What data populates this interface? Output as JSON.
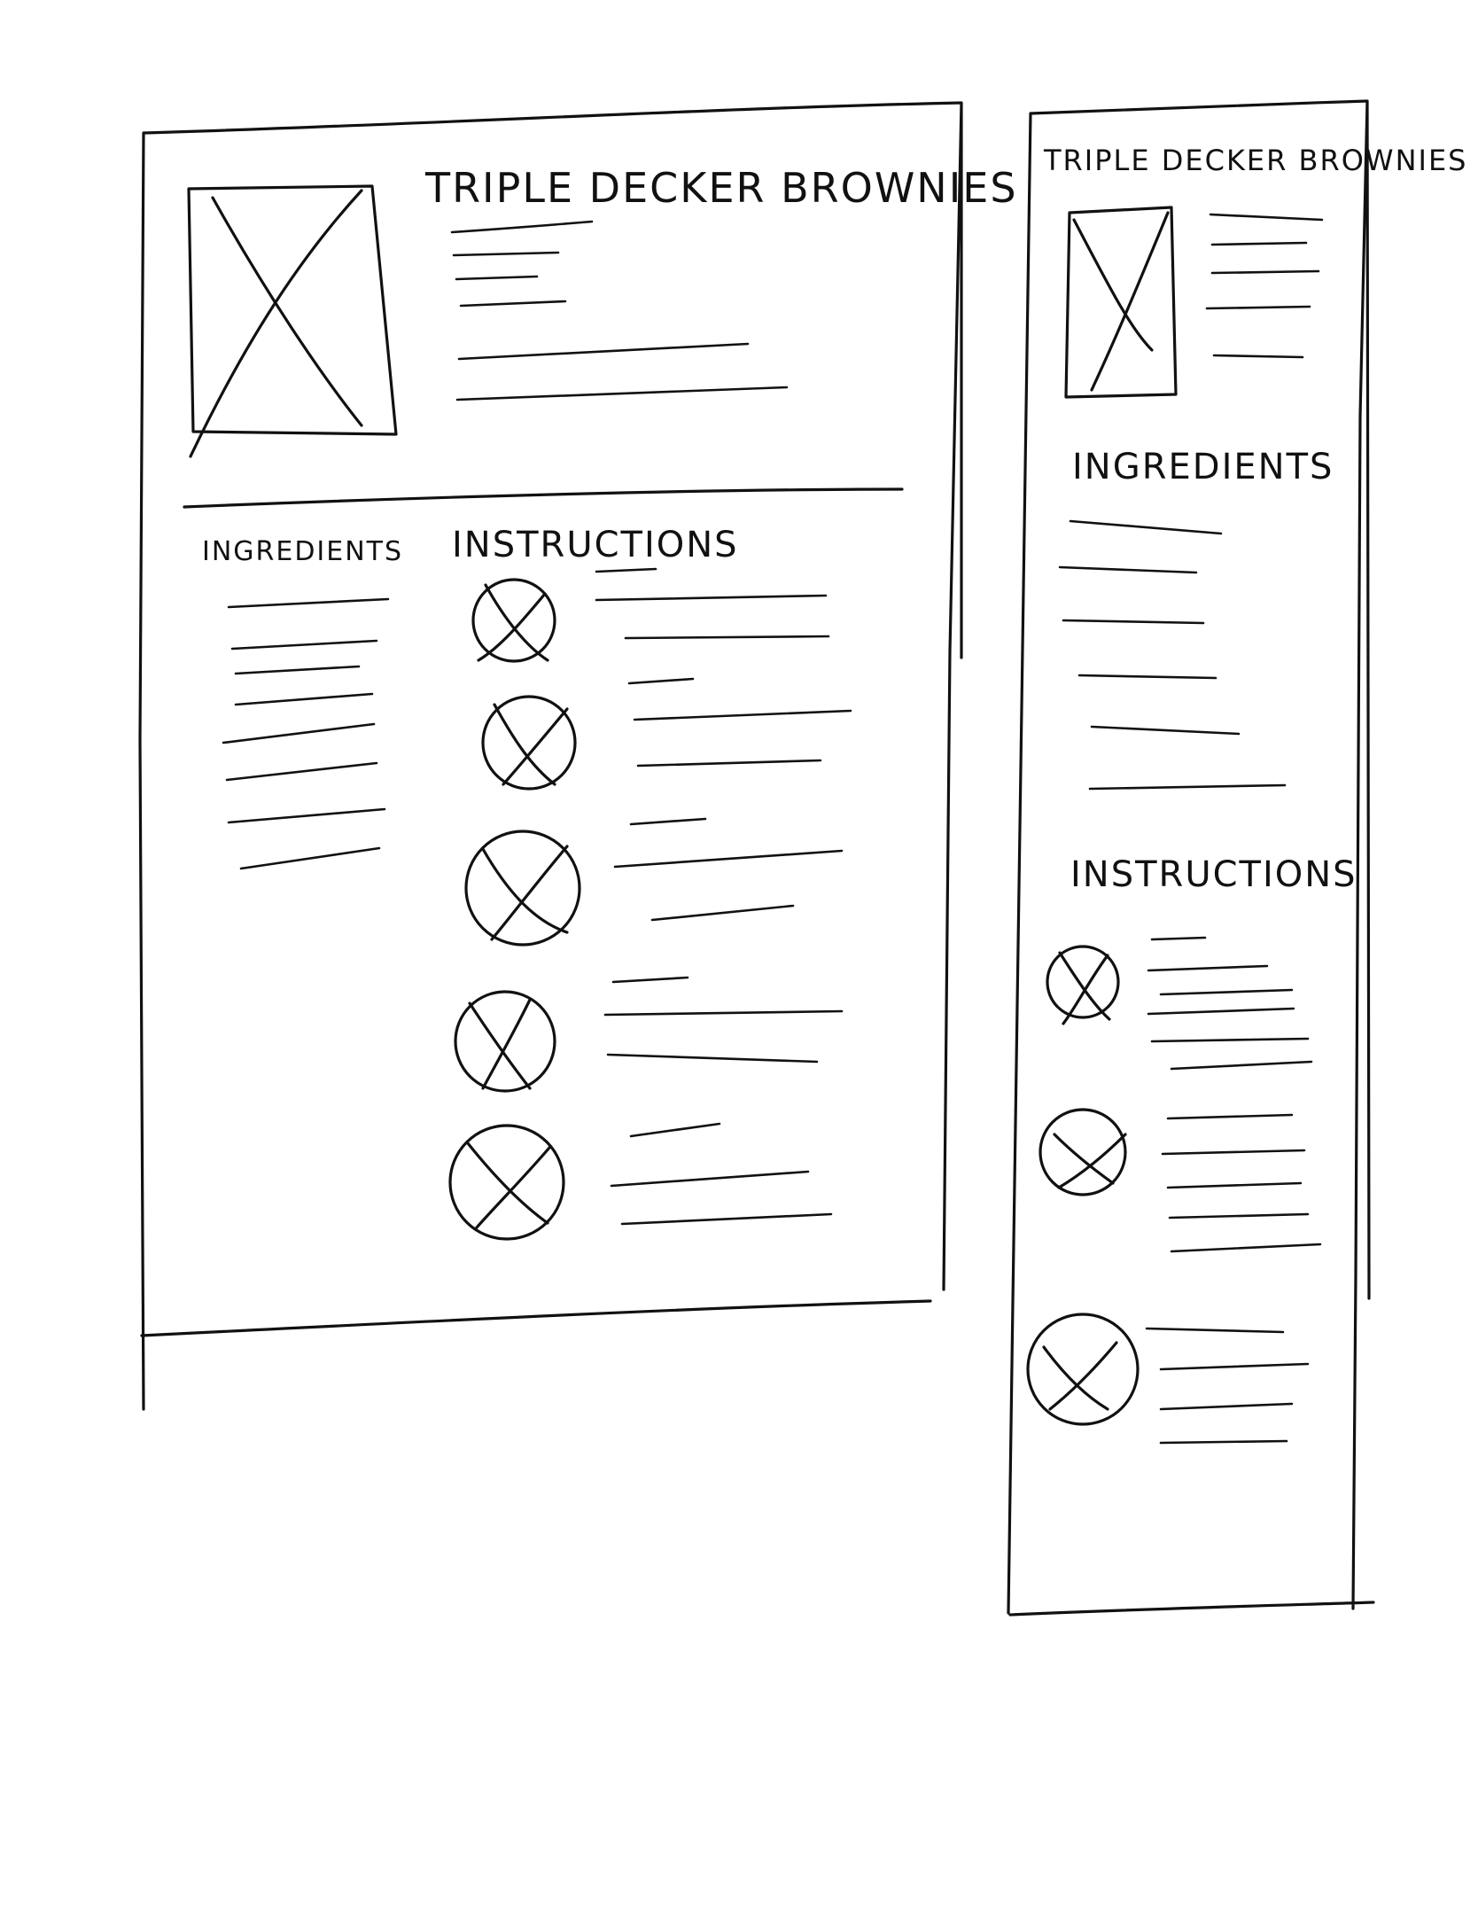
{
  "desktop": {
    "title": "TRIPLE DECKER BROWNIES",
    "ingredients_heading": "INGREDIENTS",
    "instructions_heading": "INSTRUCTIONS"
  },
  "mobile": {
    "title": "TRIPLE DECKER BROWNIES",
    "ingredients_heading": "INGREDIENTS",
    "instructions_heading": "INSTRUCTIONS"
  },
  "icons": {
    "image_placeholder": "image-placeholder-icon",
    "step_placeholder": "step-image-placeholder-icon"
  }
}
